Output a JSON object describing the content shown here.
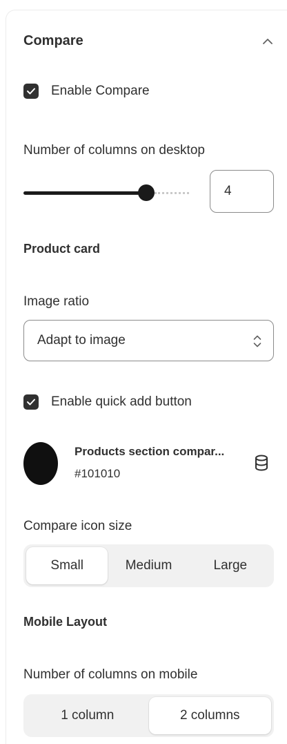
{
  "section": {
    "title": "Compare",
    "enable_compare": {
      "label": "Enable Compare",
      "checked": true
    }
  },
  "desktop_columns": {
    "label": "Number of columns on desktop",
    "value": "4",
    "slider_fraction": 0.71
  },
  "product_card": {
    "title": "Product card",
    "image_ratio": {
      "label": "Image ratio",
      "value": "Adapt to image"
    },
    "quick_add": {
      "label": "Enable quick add button",
      "checked": true
    },
    "color": {
      "name": "Products section compar...",
      "hex": "#101010",
      "swatch": "#101010"
    }
  },
  "icon_size": {
    "label": "Compare icon size",
    "options": [
      "Small",
      "Medium",
      "Large"
    ],
    "selected": "Small"
  },
  "mobile": {
    "title": "Mobile Layout",
    "columns_label": "Number of columns on mobile",
    "options": [
      "1 column",
      "2 columns"
    ],
    "selected": "2 columns"
  },
  "icons": {
    "collapse": "chevron-up-icon",
    "checkbox": "checkmark-icon",
    "select": "select-arrows-icon",
    "color_source": "database-icon"
  },
  "colors": {
    "text": "#303030",
    "checkbox_bg": "#303030",
    "segment_bg": "#f1f1f1"
  }
}
